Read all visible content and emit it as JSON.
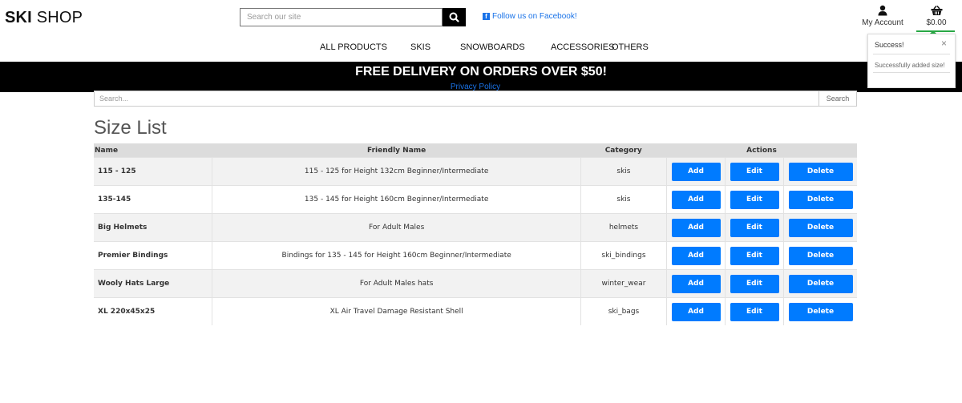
{
  "header": {
    "logo_bold": "SKI",
    "logo_rest": " SHOP",
    "search_placeholder": "Search our site",
    "facebook_text": "Follow us on Facebook!",
    "account_label": "My Account",
    "cart_total": "$0.00"
  },
  "nav": {
    "items": [
      "ALL PRODUCTS",
      "SKIS",
      "SNOWBOARDS",
      "ACCESSORIES",
      "OTHERS"
    ]
  },
  "banner": {
    "text": "FREE DELIVERY ON ORDERS OVER $50!",
    "privacy": "Privacy Policy"
  },
  "toast": {
    "title": "Success!",
    "close": "×",
    "message": "Successfully added size!"
  },
  "page": {
    "search_placeholder": "Search...",
    "search_button": "Search",
    "title": "Size List"
  },
  "table": {
    "headers": [
      "Name",
      "Friendly Name",
      "Category",
      "Actions"
    ],
    "buttons": {
      "add": "Add",
      "edit": "Edit",
      "delete": "Delete"
    },
    "rows": [
      {
        "name": "115 - 125",
        "friendly": "115 - 125 for Height 132cm Beginner/Intermediate",
        "category": "skis"
      },
      {
        "name": "135-145",
        "friendly": "135 - 145 for Height 160cm Beginner/Intermediate",
        "category": "skis"
      },
      {
        "name": "Big Helmets",
        "friendly": "For Adult Males",
        "category": "helmets"
      },
      {
        "name": "Premier Bindings",
        "friendly": "Bindings for 135 - 145 for Height 160cm Beginner/Intermediate",
        "category": "ski_bindings"
      },
      {
        "name": "Wooly Hats Large",
        "friendly": "For Adult Males hats",
        "category": "winter_wear"
      },
      {
        "name": "XL 220x45x25",
        "friendly": "XL Air Travel Damage Resistant Shell",
        "category": "ski_bags"
      }
    ]
  },
  "colors": {
    "accent": "#007bff",
    "banner_bg": "#000000",
    "success": "#28a745"
  }
}
